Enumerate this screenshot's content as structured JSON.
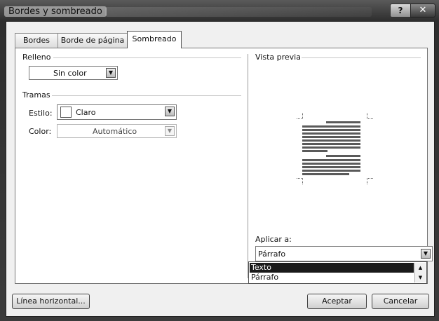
{
  "window": {
    "title": "Bordes y sombreado",
    "help": "?",
    "close": "✕"
  },
  "tabs": [
    {
      "label": "Bordes"
    },
    {
      "label": "Borde de página"
    },
    {
      "label": "Sombreado"
    }
  ],
  "relleno": {
    "label": "Relleno",
    "value": "Sin color"
  },
  "tramas": {
    "label": "Tramas",
    "estilo_label": "Estilo:",
    "estilo_value": "Claro",
    "color_label": "Color:",
    "color_value": "Automático"
  },
  "preview": {
    "label": "Vista previa"
  },
  "aplicar": {
    "label": "Aplicar a:",
    "value": "Párrafo",
    "options": [
      "Texto",
      "Párrafo"
    ]
  },
  "footer": {
    "linea_horizontal": "Línea horizontal...",
    "aceptar": "Aceptar",
    "cancelar": "Cancelar"
  }
}
